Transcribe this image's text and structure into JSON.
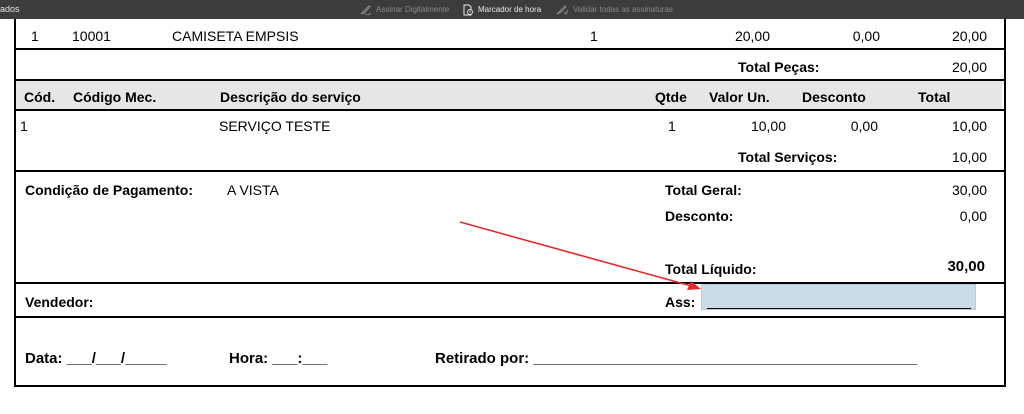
{
  "toolbar": {
    "left_text": "ados",
    "sign_label": "Assinar Digitalmente",
    "timestamp_label": "Marcador de hora",
    "validate_label": "Validar todas as assinaturas"
  },
  "parts": {
    "row": {
      "item": "1",
      "code": "10001",
      "description": "CAMISETA EMPSIS",
      "qty": "1",
      "unit": "20,00",
      "discount": "0,00",
      "total": "20,00"
    },
    "total_label": "Total Peças:",
    "total_value": "20,00"
  },
  "services": {
    "headers": {
      "cod": "Cód.",
      "mec": "Código Mec.",
      "desc": "Descrição do serviço",
      "qty": "Qtde",
      "unit": "Valor Un.",
      "discount": "Desconto",
      "total": "Total"
    },
    "row": {
      "cod": "1",
      "desc": "SERVIÇO TESTE",
      "qty": "1",
      "unit": "10,00",
      "discount": "0,00",
      "total": "10,00"
    },
    "total_label": "Total Serviços:",
    "total_value": "10,00"
  },
  "payment": {
    "label": "Condição de Pagamento:",
    "value": "A VISTA",
    "total_geral_label": "Total Geral:",
    "total_geral_value": "30,00",
    "desconto_label": "Desconto:",
    "desconto_value": "0,00",
    "total_liquido_label": "Total Líquido:",
    "total_liquido_value": "30,00"
  },
  "signature": {
    "vendedor_label": "Vendedor:",
    "ass_label": "Ass:"
  },
  "footer": {
    "data_text": "Data: ___/___/_____",
    "hora_text": "Hora: ___:___",
    "retirado_text": "Retirado por: ______________________________________________"
  },
  "colors": {
    "annotation_arrow": "#e8282b",
    "signature_field": "#c9dce8",
    "header_band": "#e6e6e6"
  }
}
